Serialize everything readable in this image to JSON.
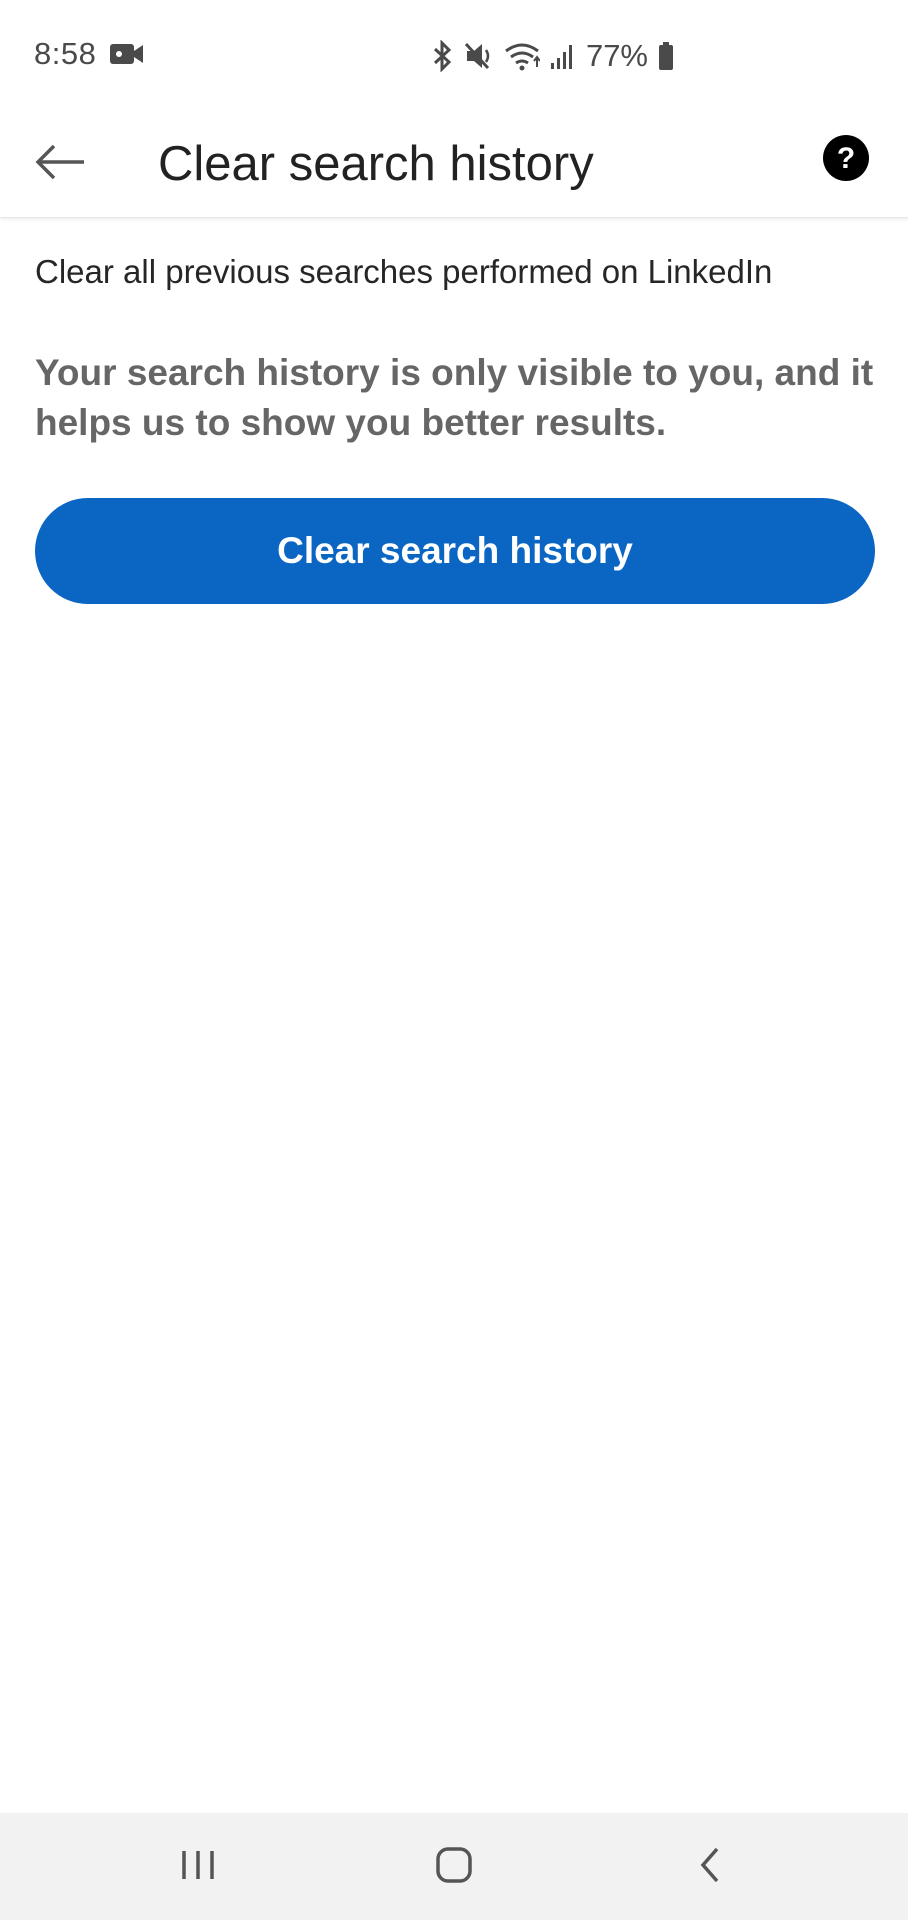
{
  "status_bar": {
    "time": "8:58",
    "battery": "77%",
    "icons": [
      "video-camera-icon",
      "bluetooth-icon",
      "mute-icon",
      "wifi-icon",
      "signal-icon",
      "battery-icon"
    ]
  },
  "app_bar": {
    "title": "Clear search history",
    "back_icon": "arrow-left-icon",
    "help_icon": "question-circle-icon"
  },
  "main": {
    "description": "Clear all previous searches performed on LinkedIn",
    "info": "Your search history is only visible to you, and it helps us to show you better results.",
    "button_label": "Clear search history"
  },
  "nav_bar": {
    "icons": [
      "recent-apps-icon",
      "home-icon",
      "back-icon"
    ]
  },
  "colors": {
    "accent": "#0a66c2",
    "info_text": "#666666",
    "nav_background": "#f2f2f2"
  }
}
